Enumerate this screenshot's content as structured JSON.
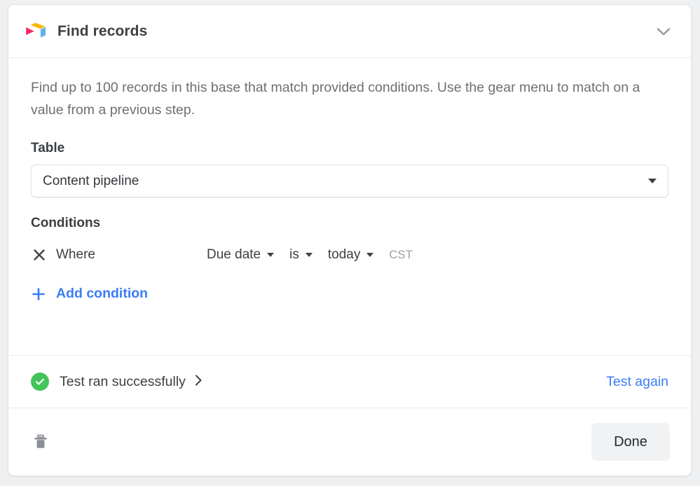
{
  "header": {
    "title": "Find records",
    "app_icon": "airtable-logo-icon",
    "collapse_icon": "chevron-down-icon"
  },
  "body": {
    "description": "Find up to 100 records in this base that match provided conditions. Use the gear menu to match on a value from a previous step.",
    "table": {
      "label": "Table",
      "selected_value": "Content pipeline",
      "dropdown_icon": "caret-down-icon"
    },
    "conditions": {
      "label": "Conditions",
      "rows": [
        {
          "remove_icon": "close-x-icon",
          "prefix": "Where",
          "field": "Due date",
          "operator": "is",
          "value": "today",
          "timezone": "CST"
        }
      ],
      "add_label": "Add condition",
      "add_icon": "plus-icon"
    }
  },
  "test": {
    "status_icon": "check-circle-icon",
    "status_text": "Test ran successfully",
    "expand_icon": "chevron-right-icon",
    "test_again_label": "Test again"
  },
  "footer": {
    "delete_icon": "trash-icon",
    "done_label": "Done"
  },
  "colors": {
    "link_blue": "#3b7df6",
    "success_green": "#44c35b",
    "page_background": "#eff0f1",
    "card_background": "#ffffff",
    "done_button_background": "#f1f2f3"
  }
}
